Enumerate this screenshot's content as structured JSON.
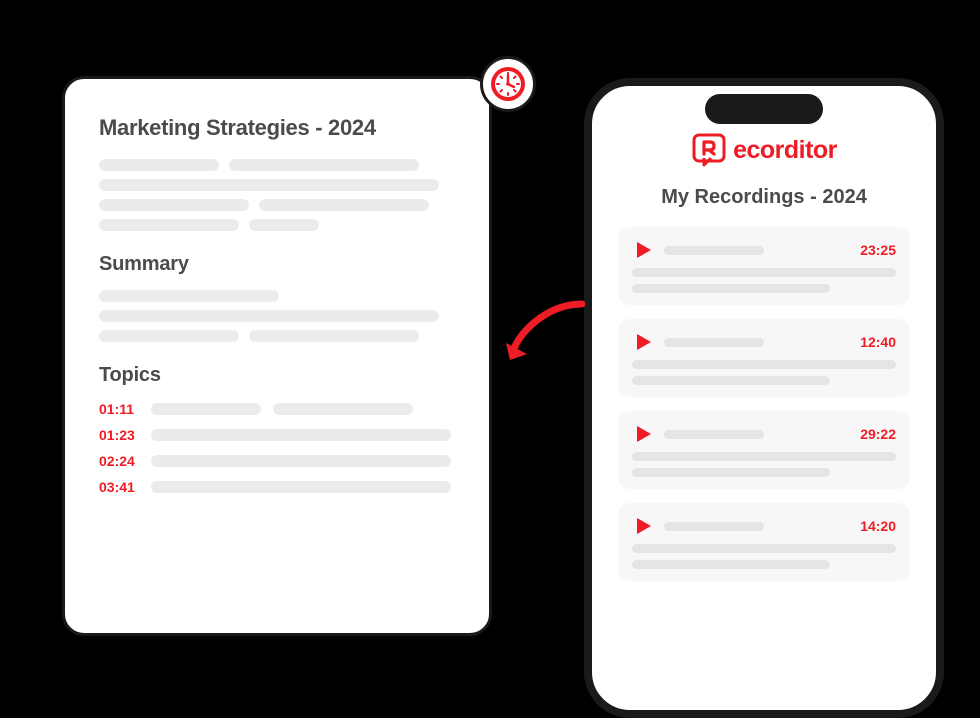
{
  "document": {
    "title": "Marketing Strategies - 2024",
    "summary_heading": "Summary",
    "topics_heading": "Topics",
    "topics": [
      {
        "time": "01:11"
      },
      {
        "time": "01:23"
      },
      {
        "time": "02:24"
      },
      {
        "time": "03:41"
      }
    ]
  },
  "phone": {
    "brand": "ecorditor",
    "title": "My Recordings - 2024",
    "recordings": [
      {
        "time": "23:25"
      },
      {
        "time": "12:40"
      },
      {
        "time": "29:22"
      },
      {
        "time": "14:20"
      }
    ]
  }
}
